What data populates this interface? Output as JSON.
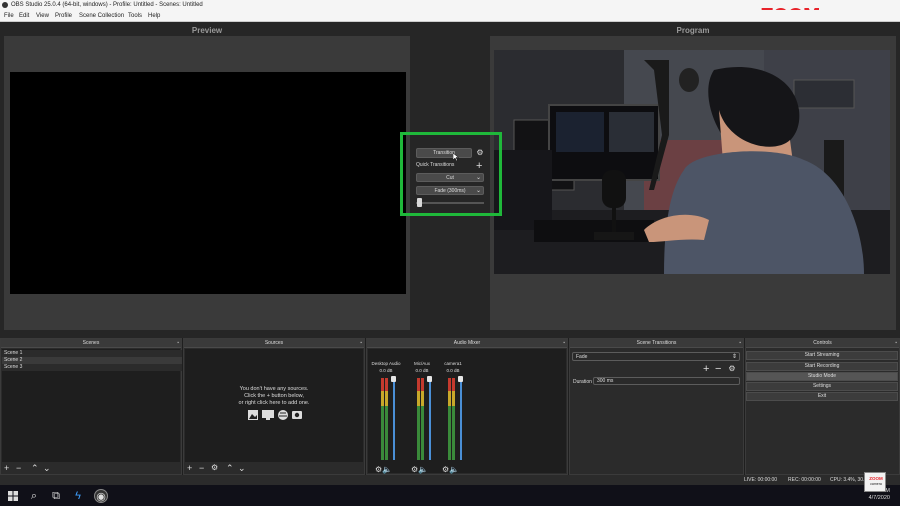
{
  "window": {
    "title": "OBS Studio 25.0.4 (64-bit, windows) - Profile: Untitled - Scenes: Untitled",
    "brand_zoom": "ZOOM",
    "brand_camera": "camera"
  },
  "menu": [
    "File",
    "Edit",
    "View",
    "Profile",
    "Scene Collection",
    "Tools",
    "Help"
  ],
  "editor": {
    "preview_label": "Preview",
    "program_label": "Program"
  },
  "transition_panel": {
    "transition_button": "Transition",
    "quick_transitions_label": "Quick Transitions",
    "cut_option": "Cut",
    "fade_option": "Fade (300ms)",
    "slider_position": 0.0,
    "icons": [
      "gear-icon",
      "plus-icon",
      "chevron-down-icon"
    ]
  },
  "docks": {
    "scenes": {
      "title": "Scenes",
      "items": [
        "Scene 1",
        "Scene 2",
        "Scene 3"
      ]
    },
    "sources": {
      "title": "Sources",
      "hint_line1": "You don't have any sources.",
      "hint_line2": "Click the + button below,",
      "hint_line3": "or right click here to add one."
    },
    "audio_mixer": {
      "title": "Audio Mixer",
      "channels": [
        {
          "name": "Desktop Audio",
          "db": "0.0 dB"
        },
        {
          "name": "Mic/Aux",
          "db": "0.0 dB"
        },
        {
          "name": "camera1",
          "db": "0.0 dB"
        }
      ]
    },
    "scene_transitions": {
      "title": "Scene Transitions",
      "selected": "Fade",
      "duration_label": "Duration",
      "duration_value": "300 ms"
    },
    "controls": {
      "title": "Controls",
      "buttons": [
        "Start Streaming",
        "Start Recording",
        "Studio Mode",
        "Settings",
        "Exit"
      ]
    }
  },
  "status": {
    "live": "LIVE: 00:00:00",
    "rec": "REC: 00:00:00",
    "cpu": "CPU: 3.4%, 30.00 fps"
  },
  "taskbar": {
    "time": "2:19 PM",
    "date": "4/7/2020"
  },
  "zoom_badge": {
    "line1": "ZOOM",
    "line2": "camera"
  },
  "colors": {
    "highlight_box": "#1fb83a",
    "brand_red": "#e8232a"
  }
}
